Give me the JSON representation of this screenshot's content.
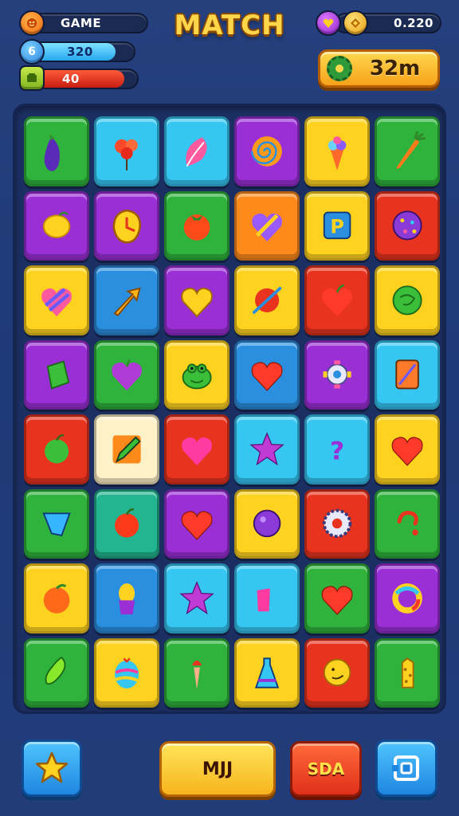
{
  "title": "MATCH",
  "hud": {
    "game_label": "GAME",
    "blue_bar": {
      "badge": "6",
      "value": "320",
      "fill_fraction": 0.82
    },
    "red_bar": {
      "value": "40",
      "fill_fraction": 0.88
    },
    "coins": "0.220",
    "timer": "32m"
  },
  "buttons": {
    "main_label": "MJJ",
    "red_label": "SDA"
  },
  "colors": {
    "green": "#2fb33c",
    "cyan": "#35c6f2",
    "blue": "#2b8fe0",
    "purple": "#9a2fd6",
    "yellow": "#ffd21f",
    "red": "#e8331e",
    "orange": "#ff8a1c",
    "teal": "#23b58f"
  },
  "board": {
    "rows": [
      [
        {
          "bg": "green",
          "icon": "eggplant-icon"
        },
        {
          "bg": "cyan",
          "icon": "balloons-icon"
        },
        {
          "bg": "cyan",
          "icon": "leaf-icon"
        },
        {
          "bg": "purple",
          "icon": "swirl-candy-icon"
        },
        {
          "bg": "yellow",
          "icon": "ice-cream-icon"
        },
        {
          "bg": "green",
          "icon": "carrot-icon"
        }
      ],
      [
        {
          "bg": "purple",
          "icon": "lemon-icon"
        },
        {
          "bg": "purple",
          "icon": "clock-icon"
        },
        {
          "bg": "green",
          "icon": "tomato-icon"
        },
        {
          "bg": "orange",
          "icon": "candy-heart-icon"
        },
        {
          "bg": "yellow",
          "icon": "letter-p-icon"
        },
        {
          "bg": "red",
          "icon": "dotted-ball-icon"
        }
      ],
      [
        {
          "bg": "yellow",
          "icon": "striped-heart-icon"
        },
        {
          "bg": "blue",
          "icon": "arrow-icon"
        },
        {
          "bg": "purple",
          "icon": "yellow-heart-icon"
        },
        {
          "bg": "yellow",
          "icon": "planet-icon"
        },
        {
          "bg": "red",
          "icon": "apple-icon"
        },
        {
          "bg": "yellow",
          "icon": "green-ball-icon"
        }
      ],
      [
        {
          "bg": "purple",
          "icon": "gem-icon"
        },
        {
          "bg": "green",
          "icon": "grape-icon"
        },
        {
          "bg": "yellow",
          "icon": "frog-icon"
        },
        {
          "bg": "blue",
          "icon": "heart-icon"
        },
        {
          "bg": "purple",
          "icon": "robot-icon"
        },
        {
          "bg": "cyan",
          "icon": "card-icon"
        }
      ],
      [
        {
          "bg": "red",
          "icon": "green-apple-icon"
        },
        {
          "bg": "cream",
          "icon": "pencil-icon"
        },
        {
          "bg": "red",
          "icon": "pink-heart-icon"
        },
        {
          "bg": "cyan",
          "icon": "star-icon"
        },
        {
          "bg": "cyan",
          "icon": "question-icon"
        },
        {
          "bg": "yellow",
          "icon": "heart-icon"
        }
      ],
      [
        {
          "bg": "green",
          "icon": "shield-icon"
        },
        {
          "bg": "teal",
          "icon": "red-apple-icon"
        },
        {
          "bg": "purple",
          "icon": "heart-icon"
        },
        {
          "bg": "yellow",
          "icon": "orb-icon"
        },
        {
          "bg": "red",
          "icon": "gear-icon"
        },
        {
          "bg": "green",
          "icon": "hook-icon"
        }
      ],
      [
        {
          "bg": "yellow",
          "icon": "peach-icon"
        },
        {
          "bg": "blue",
          "icon": "potion-icon"
        },
        {
          "bg": "cyan",
          "icon": "star-icon"
        },
        {
          "bg": "cyan",
          "icon": "cup-icon"
        },
        {
          "bg": "green",
          "icon": "heart-icon"
        },
        {
          "bg": "purple",
          "icon": "donut-icon"
        }
      ],
      [
        {
          "bg": "green",
          "icon": "pepper-icon"
        },
        {
          "bg": "yellow",
          "icon": "easter-egg-icon"
        },
        {
          "bg": "green",
          "icon": "torch-icon"
        },
        {
          "bg": "yellow",
          "icon": "bottle-icon"
        },
        {
          "bg": "red",
          "icon": "cookie-icon"
        },
        {
          "bg": "green",
          "icon": "giraffe-icon"
        }
      ]
    ]
  }
}
